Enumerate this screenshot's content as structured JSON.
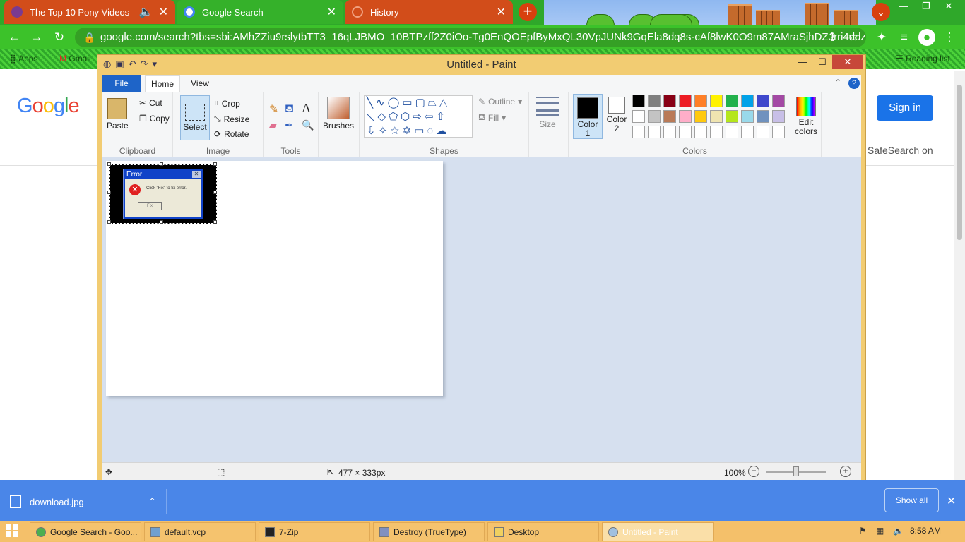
{
  "browser": {
    "tabs": [
      {
        "title": "The Top 10 Pony Videos",
        "color": "#d24d1a",
        "icon": "pony-favicon"
      },
      {
        "title": "Google Search",
        "color": "#35b12a",
        "icon": "google-favicon"
      },
      {
        "title": "History",
        "color": "#d24d1a",
        "icon": "history-icon"
      }
    ],
    "address": "google.com/search?tbs=sbi:AMhZZiu9rslytbTT3_16qLJBMO_10BTPzff2Z0iOo-Tg0EnQOEpfByMxQL30VpJUNk9GqEla8dq8s-cAf8lwK0O9m87AMraSjhDZJrri4ddz7y_1...",
    "bookmarks": [
      "Apps",
      "Gmail"
    ],
    "reading_list": "Reading list"
  },
  "google": {
    "logo": "Google",
    "signin": "Sign in",
    "safesearch": "SafeSearch on"
  },
  "paint": {
    "title": "Untitled - Paint",
    "file_tab": "File",
    "tabs": [
      "Home",
      "View"
    ],
    "clipboard": {
      "paste": "Paste",
      "cut": "Cut",
      "copy": "Copy",
      "label": "Clipboard"
    },
    "image": {
      "select": "Select",
      "crop": "Crop",
      "resize": "Resize",
      "rotate": "Rotate",
      "label": "Image"
    },
    "tools_label": "Tools",
    "brushes": "Brushes",
    "shapes": {
      "outline": "Outline",
      "fill": "Fill",
      "label": "Shapes"
    },
    "size": "Size",
    "color1": "Color\n1",
    "color2": "Color\n2",
    "edit_colors": "Edit\ncolors",
    "colors_label": "Colors",
    "palette_row1": [
      "#000000",
      "#7f7f7f",
      "#880015",
      "#ed1c24",
      "#ff7f27",
      "#fff200",
      "#22b14c",
      "#00a2e8",
      "#3f48cc",
      "#a349a4"
    ],
    "palette_row2": [
      "#ffffff",
      "#c3c3c3",
      "#b97a57",
      "#ffaec9",
      "#ffc90e",
      "#efe4b0",
      "#b5e61d",
      "#99d9ea",
      "#7092be",
      "#c8bfe7"
    ],
    "error_dialog": {
      "title": "Error",
      "message": "Click \"Fix\" to fix error.",
      "button": "Fix"
    },
    "status": {
      "dimensions": "477 × 333px",
      "zoom": "100%"
    }
  },
  "downloads": {
    "file": "download.jpg",
    "show_all": "Show all"
  },
  "taskbar": {
    "items": [
      "Google Search - Goo...",
      "default.vcp",
      "7-Zip",
      "Destroy (TrueType)",
      "Desktop",
      "Untitled - Paint"
    ],
    "clock": "8:58 AM"
  }
}
